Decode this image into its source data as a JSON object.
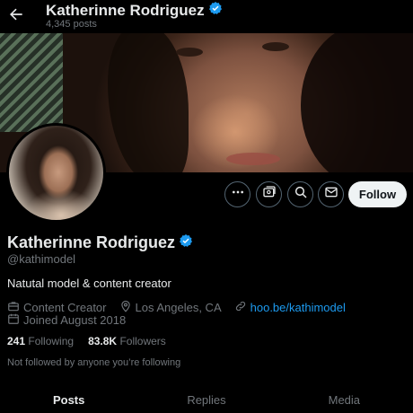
{
  "header": {
    "display_name": "Katherinne Rodriguez",
    "posts_count": "4,345 posts"
  },
  "profile": {
    "display_name": "Katherinne Rodriguez",
    "handle": "@kathimodel",
    "bio": "Natutal model & content creator",
    "category": "Content Creator",
    "location": "Los Angeles, CA",
    "website": "hoo.be/kathimodel",
    "joined": "Joined August 2018",
    "following_count": "241",
    "following_label": "Following",
    "followers_count": "83.8K",
    "followers_label": "Followers",
    "followed_by_note": "Not followed by anyone you’re following"
  },
  "actions": {
    "follow_label": "Follow"
  },
  "tabs": [
    {
      "label": "Posts",
      "active": true
    },
    {
      "label": "Replies",
      "active": false
    },
    {
      "label": "Media",
      "active": false
    }
  ],
  "colors": {
    "verified": "#1d9bf0",
    "link": "#1d9bf0",
    "muted": "#71767b"
  }
}
